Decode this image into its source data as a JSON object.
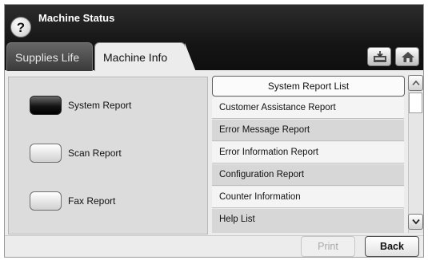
{
  "header": {
    "title": "Machine Status",
    "help_glyph": "?",
    "help_icon": "help-icon",
    "save_icon": "save-tray-icon",
    "home_icon": "home-icon"
  },
  "tabs": [
    {
      "label": "Supplies Life",
      "selected": false
    },
    {
      "label": "Machine Info",
      "selected": true
    }
  ],
  "reports": [
    {
      "label": "System Report",
      "selected": true
    },
    {
      "label": "Scan Report",
      "selected": false
    },
    {
      "label": "Fax Report",
      "selected": false
    }
  ],
  "list": {
    "header": "System Report List",
    "items": [
      "Customer Assistance Report",
      "Error Message Report",
      "Error Information Report",
      "Configuration Report",
      "Counter Information",
      "Help List"
    ]
  },
  "footer": {
    "print_label": "Print",
    "print_enabled": false,
    "back_label": "Back"
  },
  "colors": {
    "header_bg": "#151515",
    "body_bg": "#ececec",
    "selected_report": "#141414"
  }
}
